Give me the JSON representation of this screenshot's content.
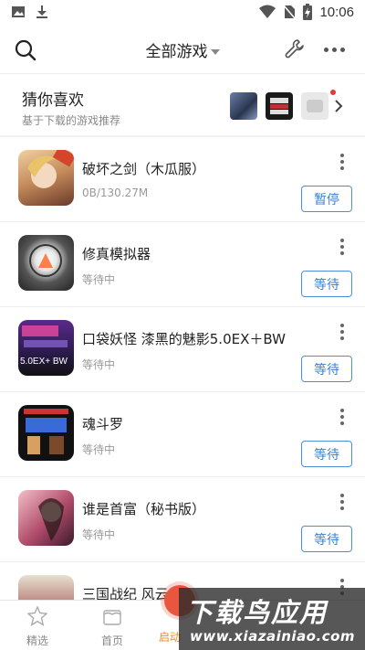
{
  "status_bar": {
    "time": "10:06",
    "left_icons": [
      "image-icon",
      "download-icon"
    ],
    "right_icons": [
      "wifi-icon",
      "no-sim-icon",
      "battery-charging-icon"
    ]
  },
  "header": {
    "title": "全部游戏",
    "icons": [
      "search-icon",
      "wrench-icon",
      "more-icon"
    ]
  },
  "guess": {
    "title": "猜你喜欢",
    "subtitle": "基于下载的游戏推荐"
  },
  "games": [
    {
      "name": "破坏之剑（木瓜服）",
      "status": "0B/130.27M",
      "action": "暂停",
      "icon_badge": "",
      "icon_color": "#c48a5a"
    },
    {
      "name": "修真模拟器",
      "status": "等待中",
      "action": "等待",
      "icon_badge": "",
      "icon_color": "#3a3a3a"
    },
    {
      "name": "口袋妖怪 漆黑的魅影5.0EX＋BW",
      "status": "等待中",
      "action": "等待",
      "icon_badge": "5.0EX+ BW",
      "icon_color": "#2a1a4a"
    },
    {
      "name": "魂斗罗",
      "status": "等待中",
      "action": "等待",
      "icon_badge": "",
      "icon_color": "#111111"
    },
    {
      "name": "谁是首富（秘书版）",
      "status": "等待中",
      "action": "等待",
      "icon_badge": "",
      "icon_color": "#b04a6a"
    },
    {
      "name": "三国战纪 风云",
      "status": "",
      "action": "",
      "icon_badge": "",
      "icon_color": "#8a2a2a"
    }
  ],
  "bottom_nav": [
    {
      "label": "精选",
      "icon": "star-icon",
      "active": false
    },
    {
      "label": "首页",
      "icon": "home-icon",
      "active": false
    },
    {
      "label": "启动",
      "icon": "launch-icon",
      "active": true
    }
  ],
  "watermark": {
    "title": "下载鸟应用",
    "url": "www.xiazainiao.com"
  },
  "colors": {
    "accent_blue": "#3c82d0",
    "accent_orange": "#f28b1c",
    "notification_red": "#e53935"
  }
}
